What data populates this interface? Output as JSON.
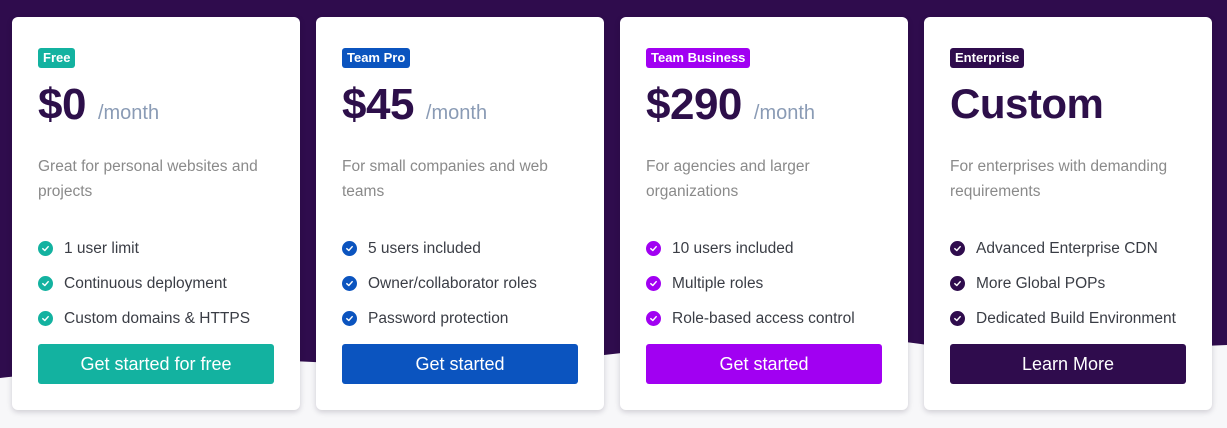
{
  "colors": {
    "background_top": "#2f0c4d",
    "background_bottom": "#f7f7f9",
    "free": "#13b2a0",
    "team_pro": "#0b54bf",
    "team_business": "#a100f2",
    "enterprise": "#2f0c4d"
  },
  "plans": [
    {
      "badge": "Free",
      "price": "$0",
      "period": "/month",
      "description": "Great for personal websites and projects",
      "features": [
        "1 user limit",
        "Continuous deployment",
        "Custom domains & HTTPS"
      ],
      "cta": "Get started for free",
      "feature_icon": "check-circle-icon"
    },
    {
      "badge": "Team Pro",
      "price": "$45",
      "period": "/month",
      "description": "For small companies and web teams",
      "features": [
        "5 users included",
        "Owner/collaborator roles",
        "Password protection"
      ],
      "cta": "Get started",
      "feature_icon": "check-circle-icon"
    },
    {
      "badge": "Team Business",
      "price": "$290",
      "period": "/month",
      "description": "For agencies and larger organizations",
      "features": [
        "10 users included",
        "Multiple roles",
        "Role-based access control"
      ],
      "cta": "Get started",
      "feature_icon": "check-circle-icon"
    },
    {
      "badge": "Enterprise",
      "price": "Custom",
      "period": "",
      "description": "For enterprises with demanding requirements",
      "features": [
        "Advanced Enterprise CDN",
        "More Global POPs",
        "Dedicated Build Environment"
      ],
      "cta": "Learn More",
      "feature_icon": "check-circle-icon"
    }
  ]
}
